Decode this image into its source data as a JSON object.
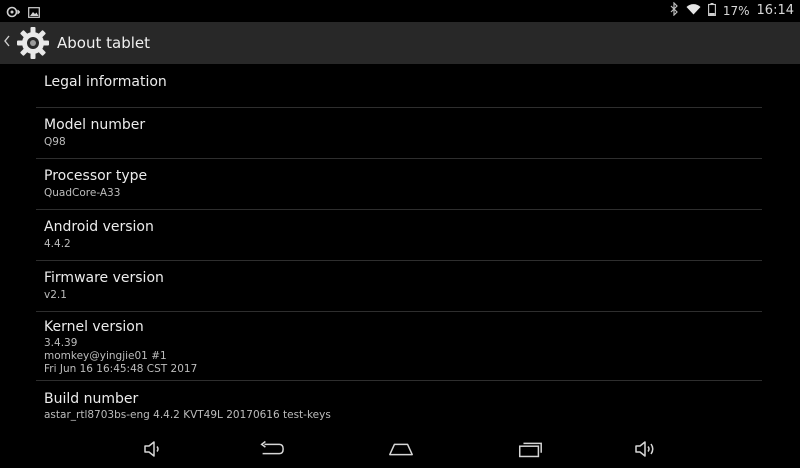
{
  "status_bar": {
    "left_icons": [
      "notification-icon",
      "image-icon"
    ],
    "battery": "17%",
    "time": "16:14"
  },
  "action_bar": {
    "title": "About tablet",
    "icon": "settings-gear-icon"
  },
  "items": [
    {
      "title": "Legal information"
    },
    {
      "title": "Model number",
      "summary": "Q98"
    },
    {
      "title": "Processor type",
      "summary": "QuadCore-A33"
    },
    {
      "title": "Android version",
      "summary": "4.4.2"
    },
    {
      "title": "Firmware version",
      "summary": "v2.1"
    },
    {
      "title": "Kernel version",
      "summary_lines": [
        "3.4.39",
        "momkey@yingjie01 #1",
        "Fri Jun 16 16:45:48 CST 2017"
      ]
    },
    {
      "title": "Build number",
      "summary": "astar_rtl8703bs-eng 4.4.2 KVT49L 20170616 test-keys"
    }
  ],
  "nav_bar": {
    "buttons": [
      "volume-down-icon",
      "back-icon",
      "home-icon",
      "recents-icon",
      "volume-up-icon"
    ]
  },
  "colors": {
    "background": "#000000",
    "action_bar": "#282828",
    "divider": "#2e2e2e",
    "text_primary": "#ececec",
    "text_secondary": "#bdbdbd"
  }
}
